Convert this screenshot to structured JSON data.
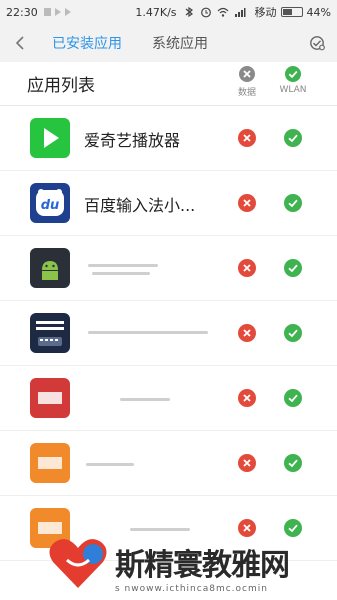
{
  "status_bar": {
    "time": "22:30",
    "net_speed": "1.47K/s",
    "carrier": "移动",
    "battery": "44%"
  },
  "header": {
    "tabs": [
      {
        "label": "已安装应用",
        "active": true
      },
      {
        "label": "系统应用",
        "active": false
      }
    ]
  },
  "list": {
    "title": "应用列表",
    "columns": {
      "data": "数据",
      "wlan": "WLAN"
    }
  },
  "apps": [
    {
      "name": "爱奇艺播放器",
      "icon": "iqiyi-icon",
      "data_allowed": false,
      "wlan_allowed": true
    },
    {
      "name": "百度输入法小...",
      "icon": "baidu-input-icon",
      "data_allowed": false,
      "wlan_allowed": true
    },
    {
      "name": "",
      "icon": "android-app-icon",
      "data_allowed": false,
      "wlan_allowed": true
    },
    {
      "name": "",
      "icon": "keyboard-app-icon",
      "data_allowed": false,
      "wlan_allowed": true
    },
    {
      "name": "",
      "icon": "red-app-icon",
      "data_allowed": false,
      "wlan_allowed": true
    },
    {
      "name": "",
      "icon": "orange-app-icon",
      "data_allowed": false,
      "wlan_allowed": true
    },
    {
      "name": "",
      "icon": "orange-app-icon",
      "data_allowed": false,
      "wlan_allowed": true
    }
  ],
  "colors": {
    "accent": "#2f95e8",
    "deny": "#e24b3b",
    "allow": "#3fb34f"
  },
  "watermark": {
    "text": "斯精寰教雅网",
    "url": "s  nwoww.icthinca8mc.ocmin"
  }
}
